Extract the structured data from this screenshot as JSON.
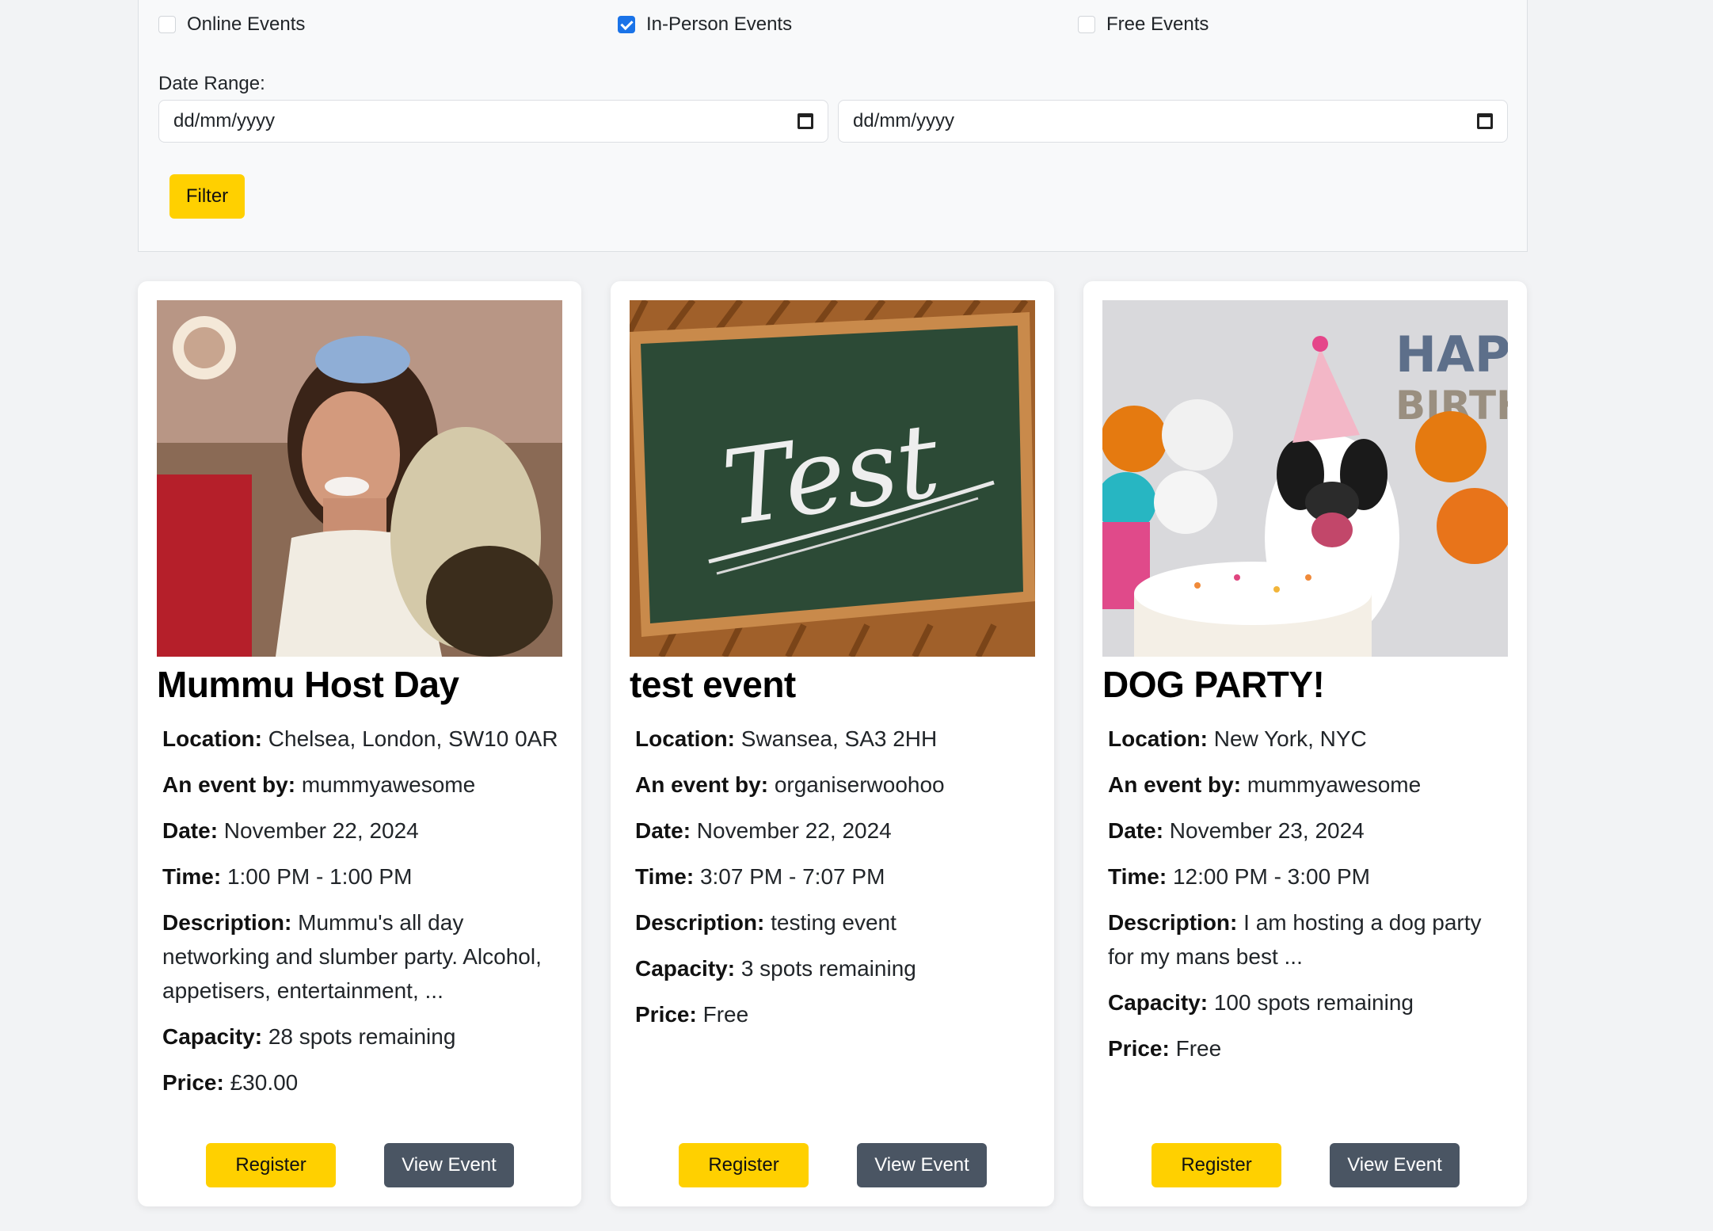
{
  "filters": {
    "online_label": "Online Events",
    "inperson_label": "In-Person Events",
    "free_label": "Free Events",
    "online_checked": false,
    "inperson_checked": true,
    "free_checked": false,
    "date_range_label": "Date Range:",
    "date_placeholder_start": "dd/mm/yyyy",
    "date_placeholder_end": "dd/mm/yyyy",
    "filter_button": "Filter"
  },
  "labels": {
    "location": "Location:",
    "by": "An event by:",
    "date": "Date:",
    "time": "Time:",
    "description": "Description:",
    "capacity": "Capacity:",
    "price": "Price:"
  },
  "buttons": {
    "register": "Register",
    "view": "View Event"
  },
  "colors": {
    "accent_yellow": "#ffd000",
    "view_button": "#4a5563",
    "checkbox_blue": "#1a73e8"
  },
  "events": [
    {
      "title": "Mummu Host Day",
      "location": "Chelsea, London, SW10 0AR",
      "organiser": "mummyawesome",
      "date": "November 22, 2024",
      "time": "1:00 PM - 1:00 PM",
      "description": "Mummu's all day networking and slumber party. Alcohol, appetisers, entertainment, ...",
      "capacity": "28 spots remaining",
      "price": "£30.00"
    },
    {
      "title": "test event",
      "location": "Swansea, SA3 2HH",
      "organiser": "organiserwoohoo",
      "date": "November 22, 2024",
      "time": "3:07 PM - 7:07 PM",
      "description": "testing event",
      "capacity": "3 spots remaining",
      "price": "Free",
      "image_text": "Test"
    },
    {
      "title": "DOG PARTY!",
      "location": "New York, NYC",
      "organiser": "mummyawesome",
      "date": "November 23, 2024",
      "time": "12:00 PM - 3:00 PM",
      "description": "I am hosting a dog party for my mans best ...",
      "capacity": "100 spots remaining",
      "price": "Free",
      "image_text_1": "HAPP",
      "image_text_2": "BIRTHDA"
    }
  ]
}
